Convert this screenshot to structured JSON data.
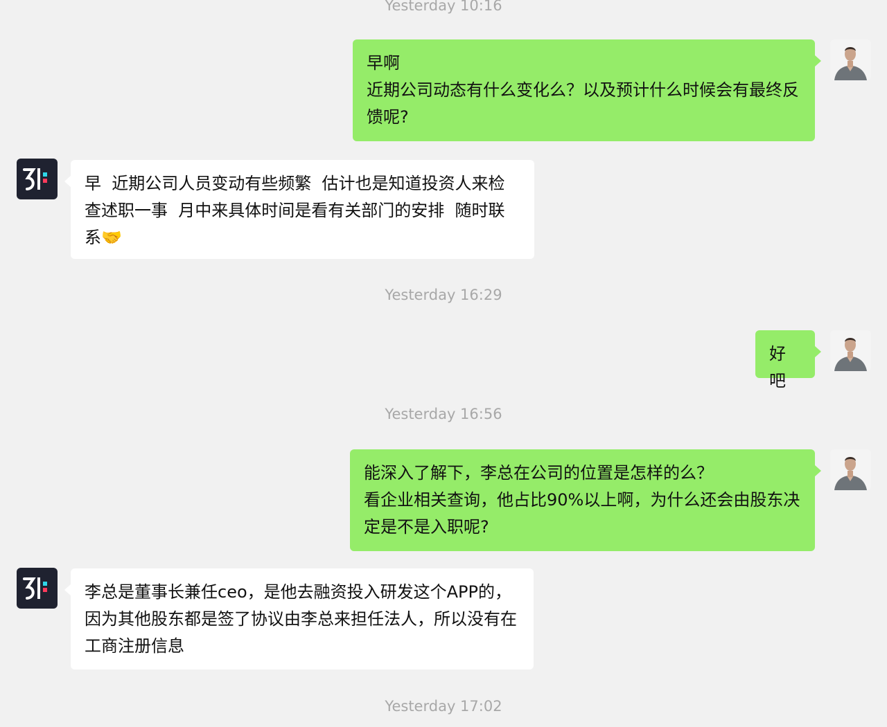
{
  "timestamps": [
    "Yesterday 10:16",
    "Yesterday 16:29",
    "Yesterday 16:56",
    "Yesterday 17:02"
  ],
  "messages": [
    {
      "direction": "outgoing",
      "text": "早啊\n近期公司动态有什么变化么？以及预计什么时候会有最终反馈呢?"
    },
    {
      "direction": "incoming",
      "text": "早  近期公司人员变动有些频繁  估计也是知道投资人来检查述职一事  月中来具体时间是看有关部门的安排  随时联系🤝"
    },
    {
      "direction": "outgoing",
      "text": "好吧"
    },
    {
      "direction": "outgoing",
      "text": "能深入了解下，李总在公司的位置是怎样的么？\n看企业相关查询，他占比90%以上啊，为什么还会由股东决定是不是入职呢?"
    },
    {
      "direction": "incoming",
      "text": "李总是董事长兼任ceo，是他去融资投入研发这个APP的，因为其他股东都是签了协议由李总来担任法人，所以没有在工商注册信息"
    }
  ],
  "colors": {
    "outgoing_bubble": "#95ec69",
    "incoming_bubble": "#ffffff",
    "background": "#f1f1f1",
    "timestamp": "#a8a8a8"
  },
  "icons": {
    "contact_avatar": "app-logo-avatar",
    "self_avatar": "user-photo-avatar"
  }
}
